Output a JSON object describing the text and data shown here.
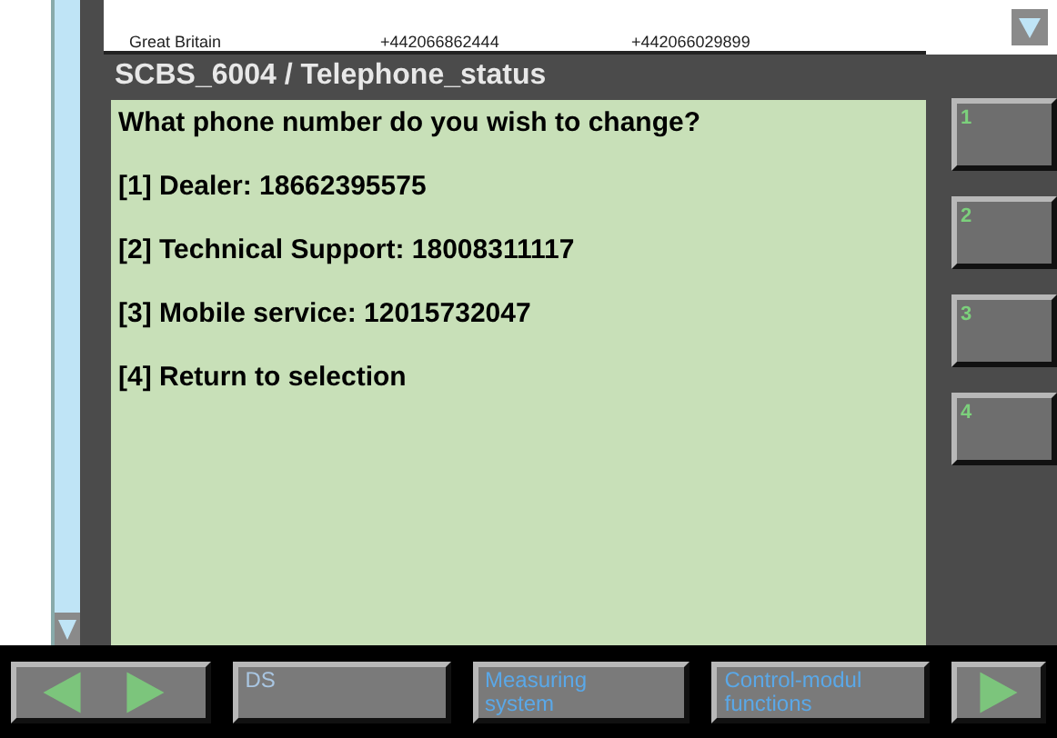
{
  "list_row": {
    "cells": [
      "Great Britain",
      "+442066862444",
      "+442066029899"
    ]
  },
  "title": "SCBS_6004 / Telephone_status",
  "prompt": "What phone number do you wish to change?",
  "options": [
    "[1] Dealer: 18662395575",
    "[2] Technical Support: 18008311117",
    "[3] Mobile service: 12015732047",
    "[4] Return to selection"
  ],
  "side_buttons": [
    {
      "label": "1"
    },
    {
      "label": "2"
    },
    {
      "label": "3"
    },
    {
      "label": "4"
    }
  ],
  "bottom_buttons": [
    {
      "label": "DS",
      "disabled": true
    },
    {
      "label": "Measuring system",
      "disabled": false
    },
    {
      "label": "Control-modul functions",
      "disabled": false
    }
  ]
}
